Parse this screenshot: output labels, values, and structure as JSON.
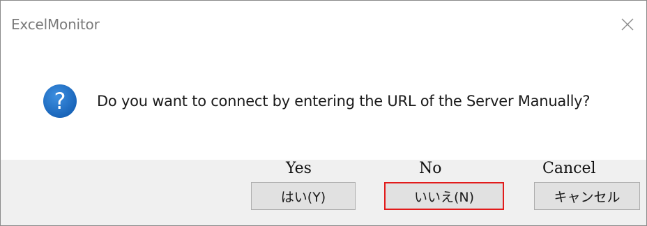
{
  "dialog": {
    "title": "ExcelMonitor",
    "message": "Do you want to connect by entering the URL of the Server Manually?",
    "icon": "question-icon",
    "icon_color": "#1f6fc5",
    "close_icon": "close-icon"
  },
  "buttons": {
    "yes": {
      "label": "はい(Y)",
      "annotation": "Yes"
    },
    "no": {
      "label": "いいえ(N)",
      "annotation": "No",
      "highlight_color": "#e21b1b"
    },
    "cancel": {
      "label": "キャンセル",
      "annotation": "Cancel"
    }
  }
}
